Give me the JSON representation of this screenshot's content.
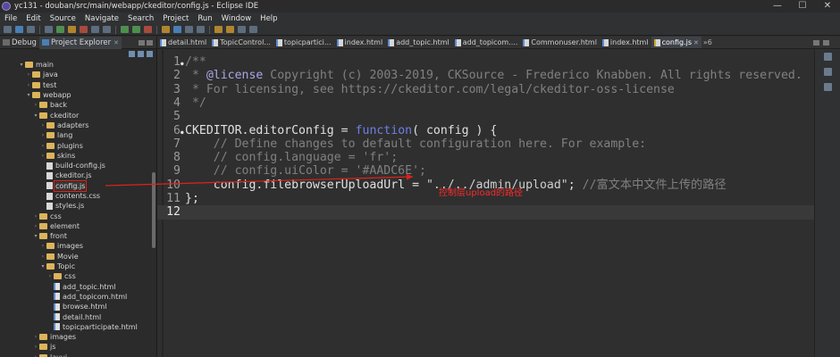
{
  "window": {
    "title": "yc131 - douban/src/main/webapp/ckeditor/config.js - Eclipse IDE",
    "controls": [
      "—",
      "☐",
      "✕"
    ]
  },
  "menu": [
    "File",
    "Edit",
    "Source",
    "Navigate",
    "Search",
    "Project",
    "Run",
    "Window",
    "Help"
  ],
  "explorer": {
    "tabs": [
      {
        "label": "Debug",
        "active": false
      },
      {
        "label": "Project Explorer",
        "active": true
      }
    ],
    "tree": [
      {
        "label": "main",
        "depth": 3,
        "type": "folder",
        "open": true
      },
      {
        "label": "java",
        "depth": 4,
        "type": "folder",
        "open": false
      },
      {
        "label": "test",
        "depth": 4,
        "type": "folder",
        "open": false
      },
      {
        "label": "webapp",
        "depth": 4,
        "type": "folder",
        "open": true
      },
      {
        "label": "back",
        "depth": 5,
        "type": "folder",
        "open": false
      },
      {
        "label": "ckeditor",
        "depth": 5,
        "type": "folder",
        "open": true
      },
      {
        "label": "adapters",
        "depth": 6,
        "type": "folder",
        "open": false
      },
      {
        "label": "lang",
        "depth": 6,
        "type": "folder",
        "open": false
      },
      {
        "label": "plugins",
        "depth": 6,
        "type": "folder",
        "open": false
      },
      {
        "label": "skins",
        "depth": 6,
        "type": "folder",
        "open": false
      },
      {
        "label": "build-config.js",
        "depth": 6,
        "type": "file"
      },
      {
        "label": "ckeditor.js",
        "depth": 6,
        "type": "file"
      },
      {
        "label": "config.js",
        "depth": 6,
        "type": "file",
        "selected": true
      },
      {
        "label": "contents.css",
        "depth": 6,
        "type": "file"
      },
      {
        "label": "styles.js",
        "depth": 6,
        "type": "file"
      },
      {
        "label": "css",
        "depth": 5,
        "type": "folder",
        "open": false
      },
      {
        "label": "element",
        "depth": 5,
        "type": "folder",
        "open": false
      },
      {
        "label": "front",
        "depth": 5,
        "type": "folder",
        "open": true
      },
      {
        "label": "images",
        "depth": 6,
        "type": "folder",
        "open": false
      },
      {
        "label": "Movie",
        "depth": 6,
        "type": "folder",
        "open": false
      },
      {
        "label": "Topic",
        "depth": 6,
        "type": "folder",
        "open": true
      },
      {
        "label": "css",
        "depth": 7,
        "type": "folder",
        "open": false
      },
      {
        "label": "add_topic.html",
        "depth": 7,
        "type": "html"
      },
      {
        "label": "add_topicom.html",
        "depth": 7,
        "type": "html"
      },
      {
        "label": "browse.html",
        "depth": 7,
        "type": "html"
      },
      {
        "label": "detail.html",
        "depth": 7,
        "type": "html"
      },
      {
        "label": "topicparticipate.html",
        "depth": 7,
        "type": "html"
      },
      {
        "label": "images",
        "depth": 5,
        "type": "folder",
        "open": false
      },
      {
        "label": "js",
        "depth": 5,
        "type": "folder",
        "open": false
      },
      {
        "label": "layui",
        "depth": 5,
        "type": "folder",
        "open": false
      }
    ]
  },
  "editor": {
    "tabs": [
      {
        "label": "detail.html",
        "kind": "html"
      },
      {
        "label": "TopicControl...",
        "kind": "html"
      },
      {
        "label": "topicpartici...",
        "kind": "html"
      },
      {
        "label": "index.html",
        "kind": "html"
      },
      {
        "label": "add_topic.html",
        "kind": "html"
      },
      {
        "label": "add_topicom....",
        "kind": "html"
      },
      {
        "label": "Commonuser.html",
        "kind": "html"
      },
      {
        "label": "index.html",
        "kind": "html"
      },
      {
        "label": "config.js",
        "kind": "js",
        "active": true
      }
    ],
    "overflow": "»6",
    "lines": [
      {
        "n": "1",
        "fold": true,
        "segs": [
          [
            "cm",
            "/**"
          ]
        ]
      },
      {
        "n": "2",
        "segs": [
          [
            "cm",
            " * "
          ],
          [
            "lic",
            "@license"
          ],
          [
            "cm",
            " Copyright (c) 2003-2019, CKSource - Frederico Knabben. All rights reserved."
          ]
        ]
      },
      {
        "n": "3",
        "segs": [
          [
            "cm",
            " * For licensing, see https://ckeditor.com/legal/ckeditor-oss-license"
          ]
        ]
      },
      {
        "n": "4",
        "segs": [
          [
            "cm",
            " */"
          ]
        ]
      },
      {
        "n": "5",
        "segs": []
      },
      {
        "n": "6",
        "fold": true,
        "segs": [
          [
            "id",
            "CKEDITOR.editorConfig = "
          ],
          [
            "kw2",
            "function"
          ],
          [
            "id",
            "( config ) {"
          ]
        ]
      },
      {
        "n": "7",
        "segs": [
          [
            "cm",
            "    // Define changes to default configuration here. For example:"
          ]
        ]
      },
      {
        "n": "8",
        "segs": [
          [
            "cm",
            "    // config.language = 'fr';"
          ]
        ]
      },
      {
        "n": "9",
        "segs": [
          [
            "cm",
            "    // config.uiColor = '#AADC6E';"
          ]
        ]
      },
      {
        "n": "10",
        "segs": [
          [
            "id",
            "    config.filebrowserUploadUrl = "
          ],
          [
            "str",
            "\"../../admin/upload\""
          ],
          [
            "id",
            "; "
          ],
          [
            "cm",
            "//富文本中文件上传的路径"
          ]
        ]
      },
      {
        "n": "11",
        "segs": [
          [
            "id",
            "};"
          ]
        ]
      },
      {
        "n": "12",
        "segs": [],
        "current": true
      }
    ]
  },
  "annotation": "控制层upload的路径",
  "colors": {
    "annotation": "#ff2a2a",
    "selection_box": "#e0221a"
  }
}
